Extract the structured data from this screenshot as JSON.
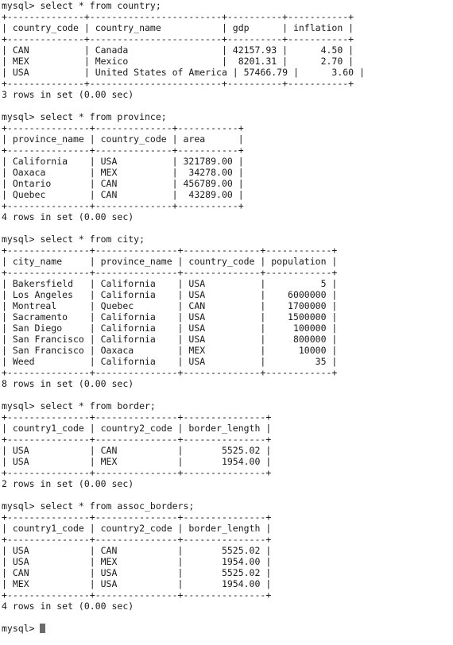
{
  "terminal": {
    "lines": [
      "mysql> select * from country;",
      "+--------------+------------------------+----------+-----------+",
      "| country_code | country_name           | gdp      | inflation |",
      "+--------------+------------------------+----------+-----------+",
      "| CAN          | Canada                 | 42157.93 |      4.50 |",
      "| MEX          | Mexico                 |  8201.31 |      2.70 |",
      "| USA          | United States of America | 57466.79 |      3.60 |",
      "+--------------+------------------------+----------+-----------+",
      "3 rows in set (0.00 sec)",
      "",
      "mysql> select * from province;",
      "+---------------+--------------+-----------+",
      "| province_name | country_code | area      |",
      "+---------------+--------------+-----------+",
      "| California    | USA          | 321789.00 |",
      "| Oaxaca        | MEX          |  34278.00 |",
      "| Ontario       | CAN          | 456789.00 |",
      "| Quebec        | CAN          |  43289.00 |",
      "+---------------+--------------+-----------+",
      "4 rows in set (0.00 sec)",
      "",
      "mysql> select * from city;",
      "+---------------+---------------+--------------+------------+",
      "| city_name     | province_name | country_code | population |",
      "+---------------+---------------+--------------+------------+",
      "| Bakersfield   | California    | USA          |          5 |",
      "| Los Angeles   | California    | USA          |    6000000 |",
      "| Montreal      | Quebec        | CAN          |    1700000 |",
      "| Sacramento    | California    | USA          |    1500000 |",
      "| San Diego     | California    | USA          |     100000 |",
      "| San Francisco | California    | USA          |     800000 |",
      "| San Francisco | Oaxaca        | MEX          |      10000 |",
      "| Weed          | California    | USA          |         35 |",
      "+---------------+---------------+--------------+------------+",
      "8 rows in set (0.00 sec)",
      "",
      "mysql> select * from border;",
      "+---------------+---------------+---------------+",
      "| country1_code | country2_code | border_length |",
      "+---------------+---------------+---------------+",
      "| USA           | CAN           |       5525.02 |",
      "| USA           | MEX           |       1954.00 |",
      "+---------------+---------------+---------------+",
      "2 rows in set (0.00 sec)",
      "",
      "mysql> select * from assoc_borders;",
      "+---------------+---------------+---------------+",
      "| country1_code | country2_code | border_length |",
      "+---------------+---------------+---------------+",
      "| USA           | CAN           |       5525.02 |",
      "| USA           | MEX           |       1954.00 |",
      "| CAN           | USA           |       5525.02 |",
      "| MEX           | USA           |       1954.00 |",
      "+---------------+---------------+---------------+",
      "4 rows in set (0.00 sec)",
      "",
      "mysql> "
    ]
  }
}
